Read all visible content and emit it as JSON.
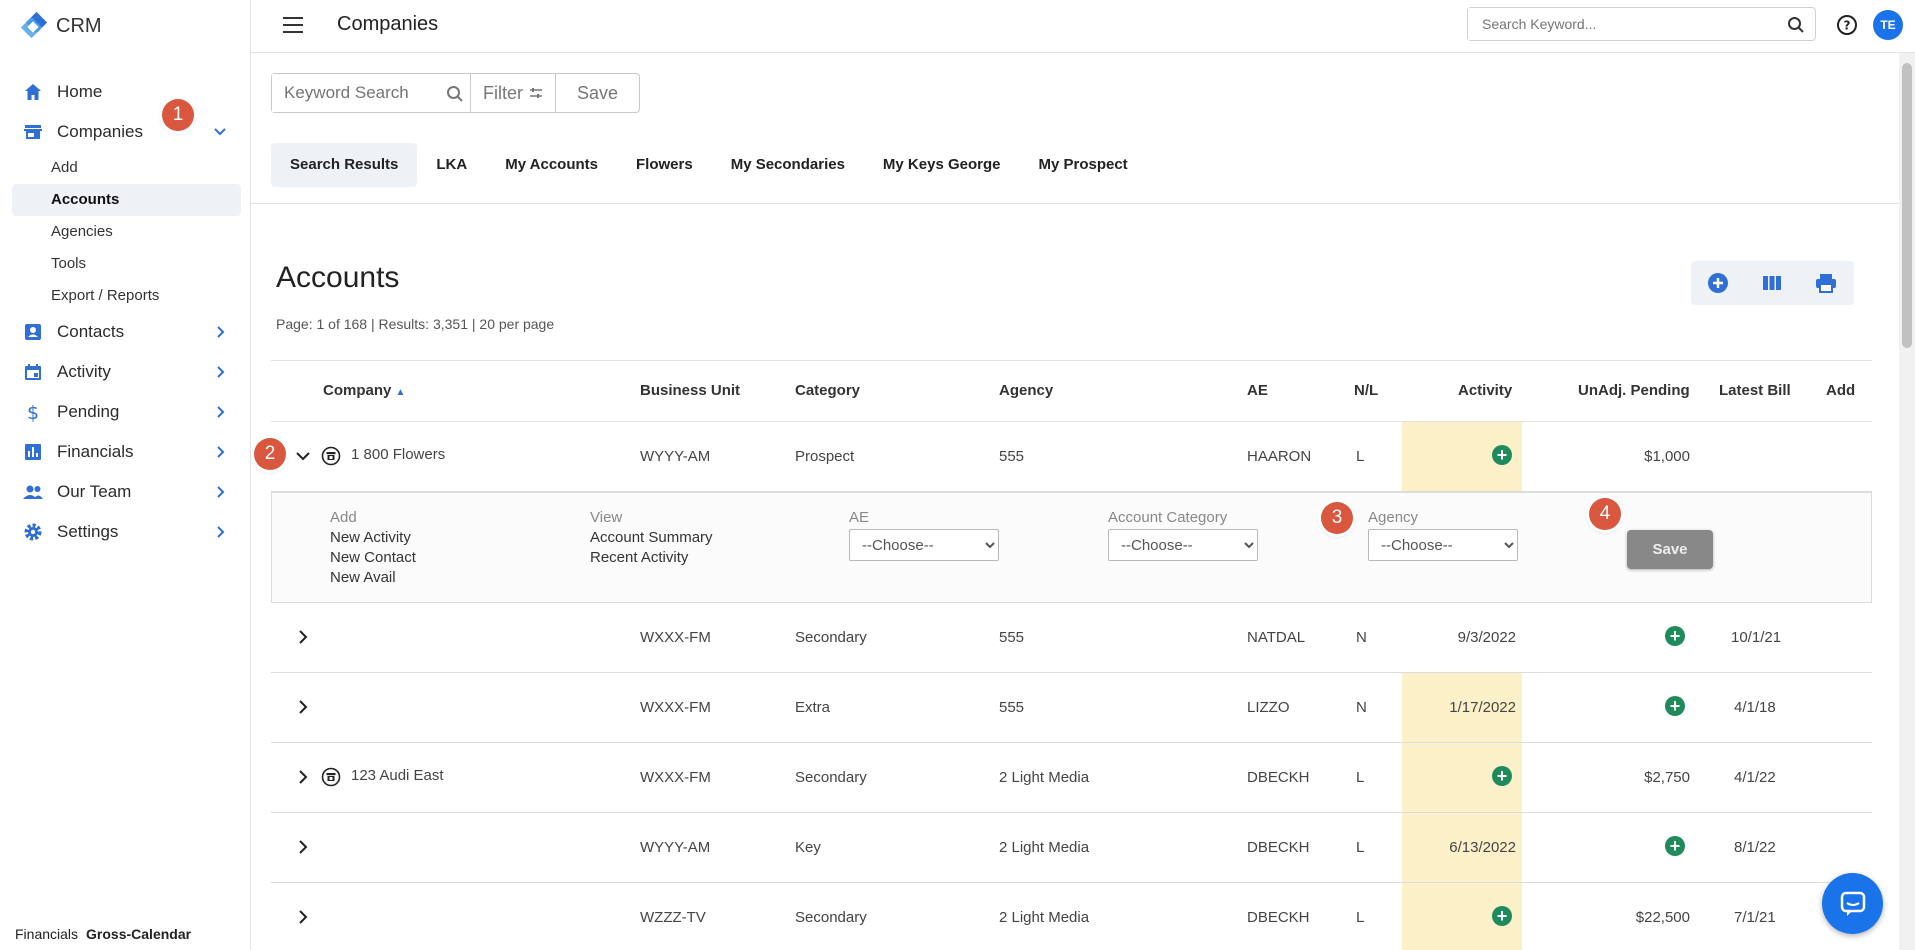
{
  "app": {
    "name": "CRM"
  },
  "sidebar": {
    "items": [
      {
        "label": "Home"
      },
      {
        "label": "Companies"
      },
      {
        "label": "Contacts"
      },
      {
        "label": "Activity"
      },
      {
        "label": "Pending"
      },
      {
        "label": "Financials"
      },
      {
        "label": "Our Team"
      },
      {
        "label": "Settings"
      }
    ],
    "companies_sub": [
      "Add",
      "Accounts",
      "Agencies",
      "Tools",
      "Export / Reports"
    ],
    "footer": {
      "section": "Financials",
      "value": "Gross-Calendar"
    }
  },
  "topbar": {
    "title": "Companies",
    "search_placeholder": "Search Keyword...",
    "avatar_initials": "TE"
  },
  "filterbar": {
    "keyword_placeholder": "Keyword Search",
    "filter_label": "Filter",
    "save_label": "Save"
  },
  "tabs": [
    "Search Results",
    "LKA",
    "My Accounts",
    "Flowers",
    "My Secondaries",
    "My Keys George",
    "My Prospect"
  ],
  "main": {
    "heading": "Accounts",
    "page_info": "Page: 1 of 168   | Results: 3,351 | 20 per page"
  },
  "table": {
    "headers": [
      "Company",
      "Business Unit",
      "Category",
      "Agency",
      "AE",
      "N/L",
      "Activity",
      "UnAdj. Pending",
      "Latest Bill",
      "Add"
    ],
    "rows": [
      {
        "company": "1 800 Flowers",
        "unit": "WYYY-AM",
        "category": "Prospect",
        "agency": "555",
        "ae": "HAARON",
        "nl": "L",
        "activity": "",
        "pending": "$1,000",
        "bill": ""
      },
      {
        "company": "",
        "unit": "WXXX-FM",
        "category": "Secondary",
        "agency": "555",
        "ae": "NATDAL",
        "nl": "N",
        "activity": "9/3/2022",
        "pending": "",
        "bill": "10/1/21"
      },
      {
        "company": "",
        "unit": "WXXX-FM",
        "category": "Extra",
        "agency": "555",
        "ae": "LIZZO",
        "nl": "N",
        "activity": "1/17/2022",
        "pending": "",
        "bill": "4/1/18"
      },
      {
        "company": "123 Audi East",
        "unit": "WXXX-FM",
        "category": "Secondary",
        "agency": "2 Light Media",
        "ae": "DBECKH",
        "nl": "L",
        "activity": "",
        "pending": "$2,750",
        "bill": "4/1/22"
      },
      {
        "company": "",
        "unit": "WYYY-AM",
        "category": "Key",
        "agency": "2 Light Media",
        "ae": "DBECKH",
        "nl": "L",
        "activity": "6/13/2022",
        "pending": "",
        "bill": "8/1/22"
      },
      {
        "company": "",
        "unit": "WZZZ-TV",
        "category": "Secondary",
        "agency": "2 Light Media",
        "ae": "DBECKH",
        "nl": "L",
        "activity": "",
        "pending": "$22,500",
        "bill": "7/1/21"
      }
    ]
  },
  "expanded": {
    "add_header": "Add",
    "add_links": [
      "New Activity",
      "New Contact",
      "New Avail"
    ],
    "view_header": "View",
    "view_links": [
      "Account Summary",
      "Recent Activity"
    ],
    "ae_label": "AE",
    "category_label": "Account Category",
    "agency_label": "Agency",
    "choose": "--Choose--",
    "save_label": "Save"
  },
  "badges": [
    "1",
    "2",
    "3",
    "4"
  ],
  "colors": {
    "accent": "#1a73e8",
    "activity_bg": "#fcf0c8",
    "plus": "#1f8a5b",
    "badge": "#d9573f"
  }
}
